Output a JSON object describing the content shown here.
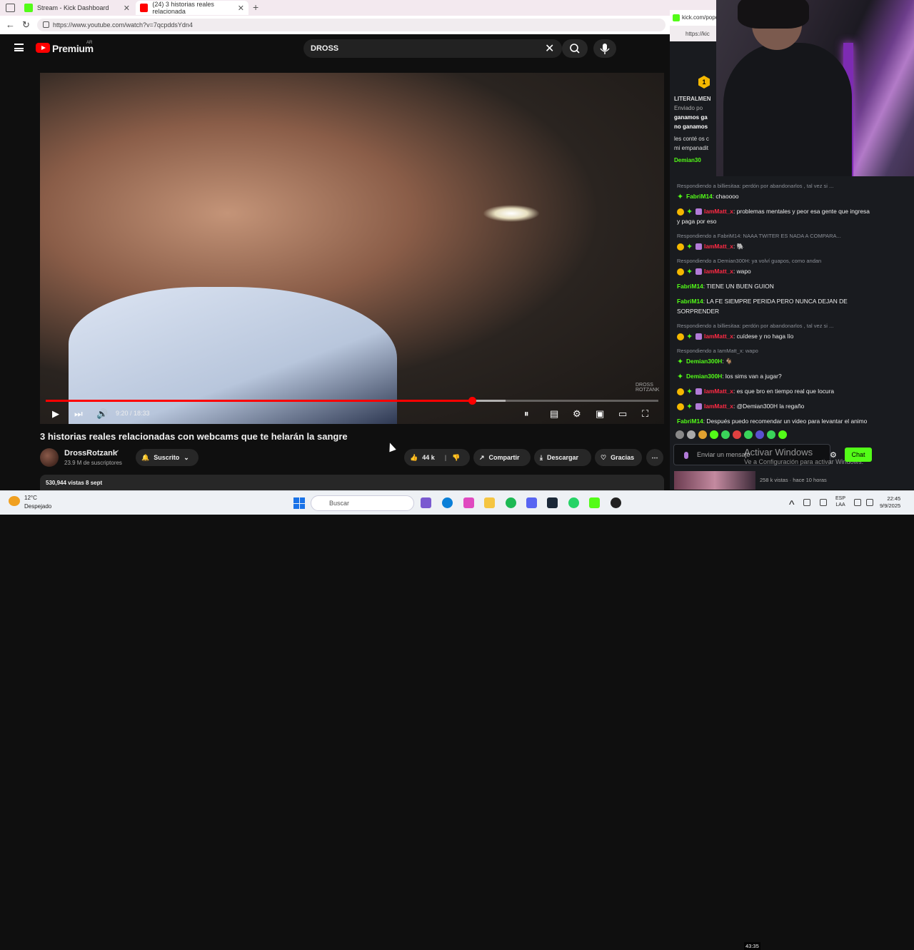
{
  "browser": {
    "tabs": [
      {
        "title": "Stream - Kick Dashboard",
        "icon": "kick-icon"
      },
      {
        "title": "(24) 3 historias reales relacionada",
        "icon": "youtube-icon"
      }
    ],
    "url": "https://www.youtube.com/watch?v=7qcpddsYdn4"
  },
  "youtube": {
    "brand": "Premium",
    "region": "AR",
    "search_query": "DROSS",
    "player": {
      "time": "9:20 / 18:33",
      "progress": 0.6962,
      "buffered": 0.75,
      "watermark": "DROSS ROTZANK"
    },
    "video_title": "3 historias reales relacionadas con webcams que te helarán la sangre",
    "channel": {
      "name": "DrossRotzank",
      "subs": "23.9 M de suscriptores",
      "verified_icon": "verified-check-icon"
    },
    "actions": {
      "subscribe": "Suscrito",
      "likes": "44 k",
      "share": "Compartir",
      "download": "Descargar",
      "thanks": "Gracias"
    },
    "views": "530,944 vistas  8 sept"
  },
  "kick": {
    "window_title": "kick.com/popo",
    "url": "https://kic",
    "rank": "1",
    "pinned": {
      "lines": [
        "LITERALMEN",
        "Enviado po",
        "ganamos ga",
        "no ganamos",
        "les conté os c",
        "mi empanadit",
        "Demian30"
      ]
    },
    "messages": [
      {
        "reply": "Respondiendo a billiesitaa: perdón por abandonarlos , tal vez si ...",
        "badges": [
          "green"
        ],
        "user": "FabriM14",
        "color": "green",
        "text": ": chaoooo"
      },
      {
        "reply": "",
        "badges": [
          "gold",
          "green",
          "sub"
        ],
        "user": "IamMatt_x",
        "color": "red",
        "text": ": problemas mentales y peor esa gente que ingresa y paga por eso"
      },
      {
        "reply": "Respondiendo a FabriM14: NAAA TWITER ES NADA A COMPARA...",
        "badges": [
          "gold",
          "green",
          "sub"
        ],
        "user": "IamMatt_x",
        "color": "red",
        "text": ": 🐘"
      },
      {
        "reply": "Respondiendo a Demian300H: ya volví guapos, como andan",
        "badges": [
          "gold",
          "green",
          "sub"
        ],
        "user": "IamMatt_x",
        "color": "red",
        "text": ": wapo"
      },
      {
        "reply": "",
        "badges": [],
        "user": "FabriM14",
        "color": "green",
        "text": ": TIENE UN BUEN GUION"
      },
      {
        "reply": "",
        "badges": [],
        "user": "FabriM14",
        "color": "green",
        "text": ": LA FE SIEMPRE PERIDA PERO NUNCA DEJAN DE SORPRENDER"
      },
      {
        "reply": "Respondiendo a billiesitaa: perdón por abandonarlos , tal vez si ...",
        "badges": [
          "gold",
          "green",
          "sub"
        ],
        "user": "IamMatt_x",
        "color": "red",
        "text": ": cuídese y no haga lío"
      },
      {
        "reply": "Respondiendo a IamMatt_x: wapo",
        "badges": [
          "green"
        ],
        "user": "Demian300H",
        "color": "green",
        "text": ": 🐐"
      },
      {
        "reply": "",
        "badges": [
          "green"
        ],
        "user": "Demian300H",
        "color": "green",
        "text": ": los sims van a jugar?"
      },
      {
        "reply": "",
        "badges": [
          "gold",
          "green",
          "sub"
        ],
        "user": "IamMatt_x",
        "color": "red",
        "text": ": es que bro en tiempo real que locura"
      },
      {
        "reply": "",
        "badges": [
          "gold",
          "green",
          "sub"
        ],
        "user": "IamMatt_x",
        "color": "red",
        "text": ": @Demian300H la regaño"
      },
      {
        "reply": "",
        "badges": [],
        "user": "FabriM14",
        "color": "green",
        "text": ": Después puedo recomendar un video para levantar el animo"
      }
    ],
    "input_placeholder": "Enviar un mensaje",
    "chat_button": "Chat",
    "next_video": {
      "duration": "43:35",
      "meta": "258 k vistas · hace 10 horas"
    }
  },
  "windows_activation": {
    "title": "Activar Windows",
    "sub": "Ve a Configuración para activar Windows."
  },
  "taskbar": {
    "weather_temp": "12°C",
    "weather_cond": "Despejado",
    "search_label": "Buscar",
    "lang": "ESP",
    "lang2": "LAA",
    "time": "22:45",
    "date": "9/9/2025"
  },
  "colors": {
    "kick_green": "#53fc18",
    "yt_red": "#ff0000"
  }
}
